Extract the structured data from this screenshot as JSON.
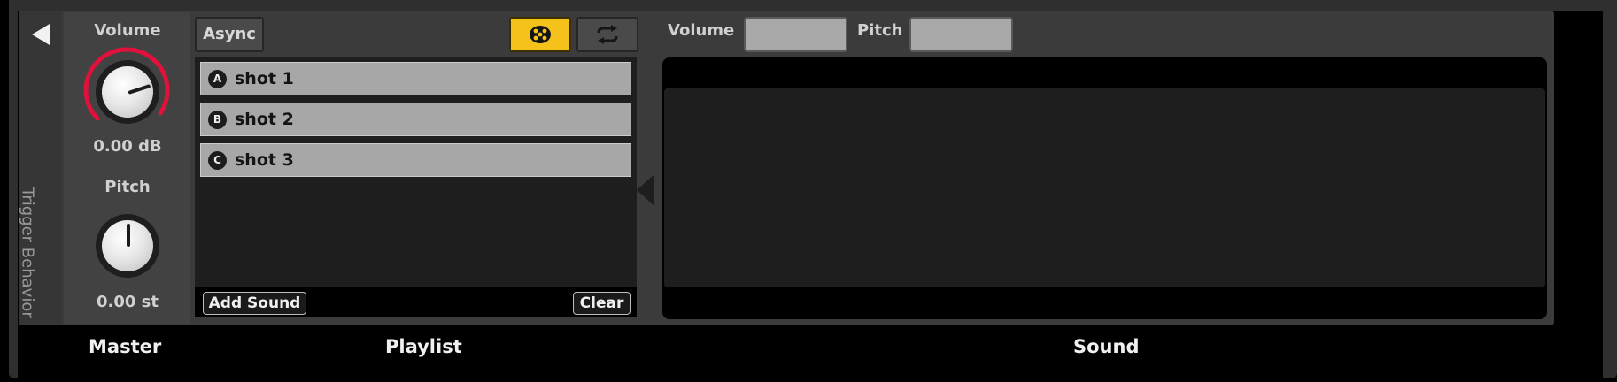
{
  "sidebar": {
    "trigger_label": "Trigger Behavior"
  },
  "master": {
    "volume_label": "Volume",
    "volume_value": "0.00 dB",
    "pitch_label": "Pitch",
    "pitch_value": "0.00 st"
  },
  "playlist": {
    "mode_label": "Async",
    "items": [
      {
        "badge": "A",
        "label": "shot 1"
      },
      {
        "badge": "B",
        "label": "shot 2"
      },
      {
        "badge": "C",
        "label": "shot 3"
      }
    ],
    "add_label": "Add Sound",
    "clear_label": "Clear"
  },
  "sound": {
    "volume_label": "Volume",
    "pitch_label": "Pitch"
  },
  "sections": {
    "master": "Master",
    "playlist": "Playlist",
    "sound": "Sound"
  },
  "colors": {
    "accent_yellow": "#f4c21a",
    "knob_arc": "#e0123c"
  },
  "icons": {
    "collapse": "triangle-left-icon",
    "random": "dice-icon",
    "loop": "loop-icon"
  }
}
